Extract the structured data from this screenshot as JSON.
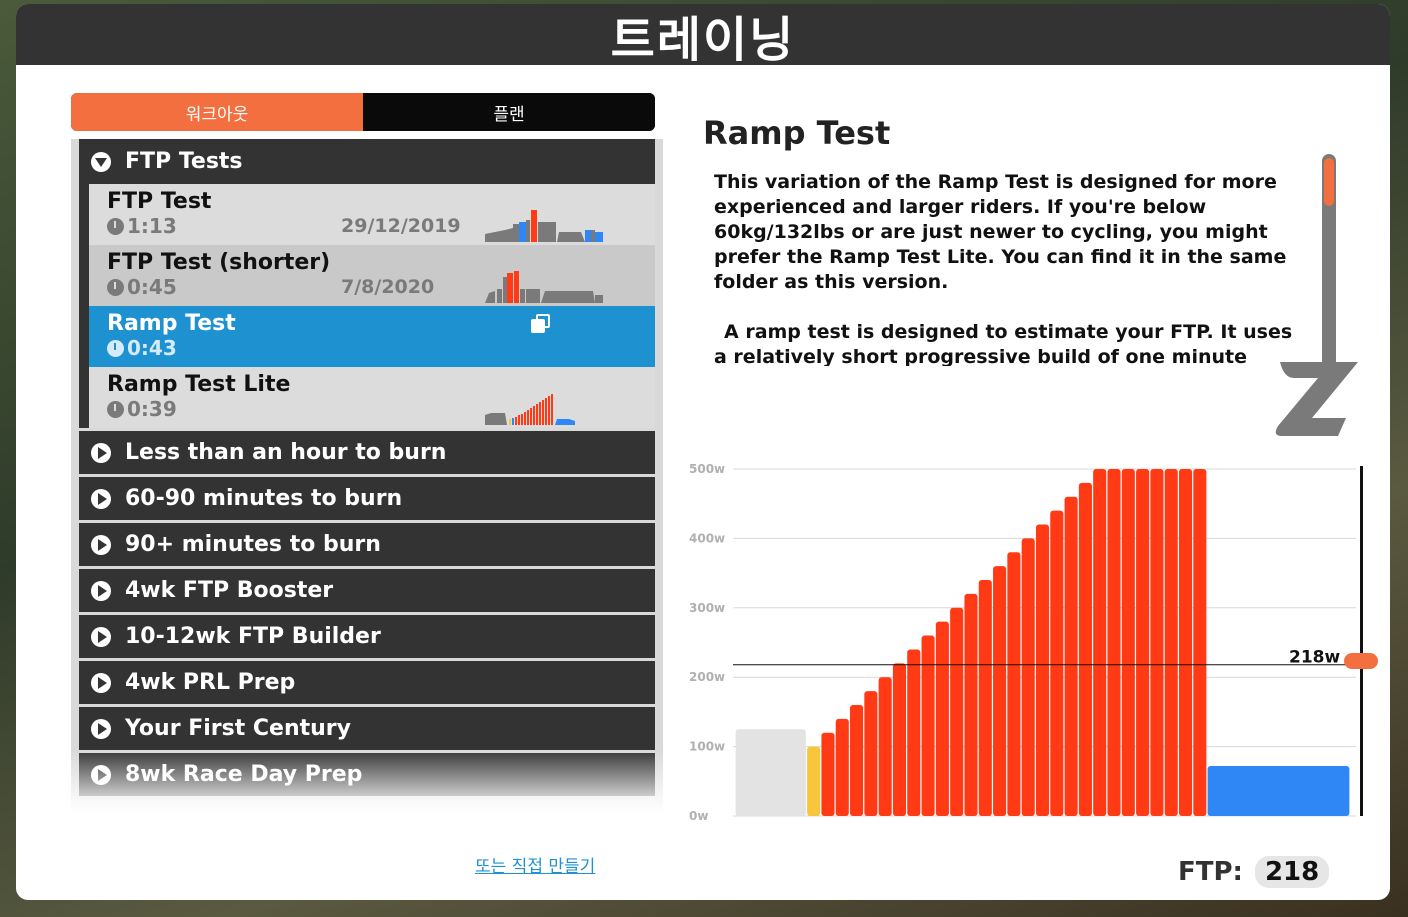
{
  "window": {
    "title": "트레이닝"
  },
  "tabs": [
    {
      "label": "워크아웃",
      "active": true
    },
    {
      "label": "플랜",
      "active": false
    }
  ],
  "open_folder": {
    "label": "FTP Tests",
    "items": [
      {
        "name": "FTP Test",
        "duration": "1:13",
        "date": "29/12/2019",
        "selected": false
      },
      {
        "name": "FTP Test (shorter)",
        "duration": "0:45",
        "date": "7/8/2020",
        "selected": false
      },
      {
        "name": "Ramp Test",
        "duration": "0:43",
        "date": "",
        "selected": true
      },
      {
        "name": "Ramp Test Lite",
        "duration": "0:39",
        "date": "",
        "selected": false
      }
    ]
  },
  "folders": [
    "Less than an hour to burn",
    "60-90 minutes to burn",
    "90+ minutes to burn",
    "4wk FTP Booster",
    "10-12wk FTP Builder",
    "4wk PRL Prep",
    "Your First Century",
    "8wk Race Day Prep"
  ],
  "detail": {
    "title": "Ramp Test",
    "description": [
      "This variation of the Ramp Test is designed for more experienced and larger riders. If you're below 60kg/132lbs or are just newer to cycling, you might prefer the Ramp Test Lite. You can find it in the same folder as this version.",
      "A ramp test is designed to estimate your FTP. It uses a relatively short progressive build of one minute steps to"
    ]
  },
  "chart_data": {
    "type": "bar",
    "ylabel_ticks": [
      "500w",
      "400w",
      "300w",
      "200w",
      "100w",
      "0w"
    ],
    "ylim": [
      0,
      500
    ],
    "ftp_line_label": "218w",
    "ftp_value": 218,
    "segments": [
      {
        "kind": "warmup",
        "color": "#e3e3e3",
        "width_units": 5,
        "value": 125
      },
      {
        "kind": "z3",
        "color": "#f7c63c",
        "width_units": 1,
        "value": 100
      },
      {
        "kind": "ramp",
        "color": "#ff3a14",
        "width_units": 27,
        "values": [
          120,
          140,
          160,
          180,
          200,
          220,
          240,
          260,
          280,
          300,
          320,
          340,
          360,
          380,
          400,
          420,
          440,
          460,
          480,
          500,
          500,
          500,
          500,
          500,
          500,
          500,
          500
        ]
      },
      {
        "kind": "cooldown",
        "color": "#2f87f5",
        "width_units": 10,
        "value": 72
      }
    ]
  },
  "footer": {
    "custom_link": "또는 직접 만들기",
    "ftp_label": "FTP:",
    "ftp_value": "218"
  },
  "colors": {
    "accent": "#f36f3f",
    "selected": "#1e91d0",
    "dark": "#333333"
  }
}
